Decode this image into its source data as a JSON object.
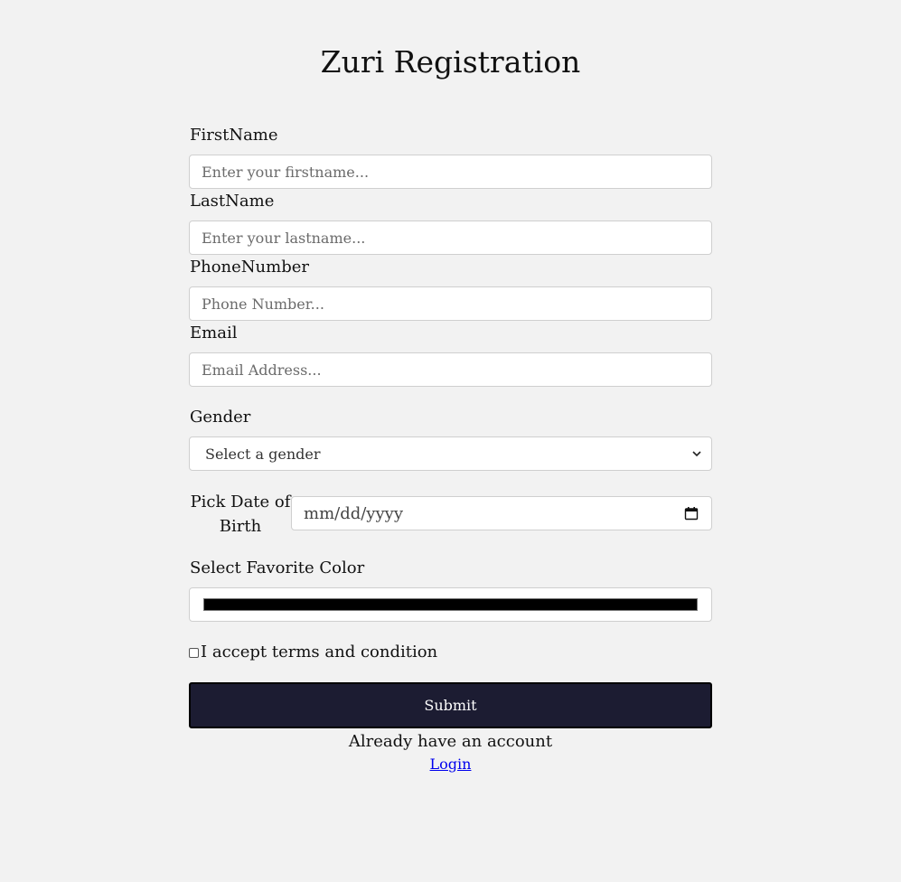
{
  "title": "Zuri Registration",
  "fields": {
    "firstname": {
      "label": "FirstName",
      "placeholder": "Enter your firstname...",
      "value": ""
    },
    "lastname": {
      "label": "LastName",
      "placeholder": "Enter your lastname...",
      "value": ""
    },
    "phone": {
      "label": "PhoneNumber",
      "placeholder": "Phone Number...",
      "value": ""
    },
    "email": {
      "label": "Email",
      "placeholder": "Email Address...",
      "value": ""
    }
  },
  "gender": {
    "label": "Gender",
    "selected": "Select a gender"
  },
  "dob": {
    "label": "Pick Date of Birth",
    "placeholder": "mm/dd/yyyy"
  },
  "favorite_color": {
    "label": "Select Favorite Color",
    "value": "#000000"
  },
  "terms": {
    "label": "I accept terms and condition",
    "checked": false
  },
  "submit": {
    "label": "Submit",
    "color": "#1c1c32"
  },
  "footer": {
    "already_text": "Already have an account",
    "login_label": "Login"
  }
}
